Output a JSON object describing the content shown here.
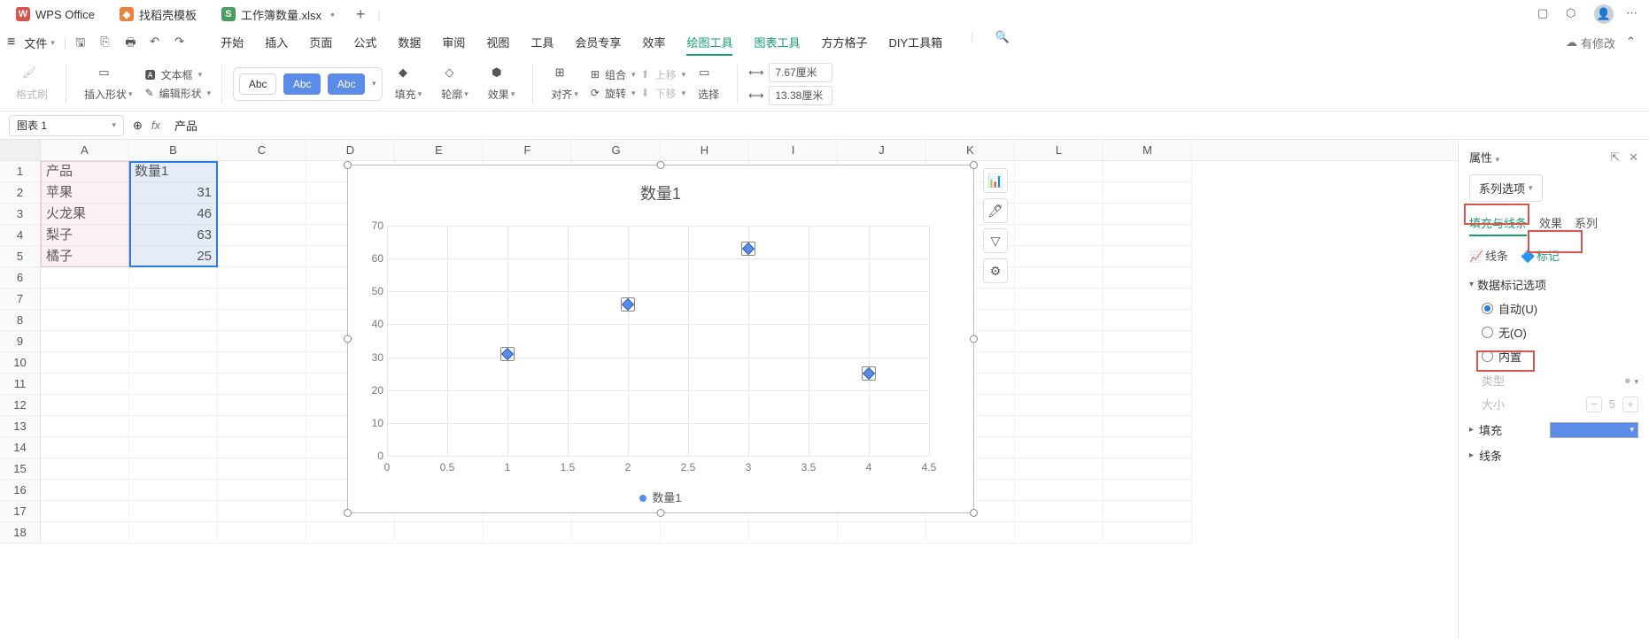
{
  "title_tabs": [
    {
      "icon": "wps",
      "label": "WPS Office"
    },
    {
      "icon": "orange",
      "label": "找稻壳模板"
    },
    {
      "icon": "green",
      "label": "工作簿数量.xlsx",
      "active": true,
      "closable": true
    }
  ],
  "menu": {
    "file": "文件",
    "tabs": [
      "开始",
      "插入",
      "页面",
      "公式",
      "数据",
      "审阅",
      "视图",
      "工具",
      "会员专享",
      "效率",
      "绘图工具",
      "图表工具",
      "方方格子",
      "DIY工具箱"
    ],
    "active_green": [
      "绘图工具",
      "图表工具"
    ],
    "cloud": "有修改"
  },
  "ribbon": {
    "format_painter": "格式刷",
    "insert_shape": "插入形状",
    "text_box": "文本框",
    "edit_shape": "编辑形状",
    "abc": "Abc",
    "fill": "填充",
    "outline": "轮廓",
    "effect": "效果",
    "align": "对齐",
    "group": "组合",
    "rotate": "旋转",
    "up": "上移",
    "down": "下移",
    "select": "选择",
    "w": "7.67厘米",
    "h": "13.38厘米"
  },
  "name_box": "图表 1",
  "fx_val": "产品",
  "columns": [
    "A",
    "B",
    "C",
    "D",
    "E",
    "F",
    "G",
    "H",
    "I",
    "J",
    "K",
    "L",
    "M"
  ],
  "rows_count": 18,
  "cells": {
    "A1": "产品",
    "B1": "数量1",
    "A2": "苹果",
    "B2": "31",
    "A3": "火龙果",
    "B3": "46",
    "A4": "梨子",
    "B4": "63",
    "A5": "橘子",
    "B5": "25"
  },
  "chart_data": {
    "type": "scatter",
    "title": "数量1",
    "series": [
      {
        "name": "数量1",
        "x": [
          1,
          2,
          3,
          4
        ],
        "y": [
          31,
          46,
          63,
          25
        ]
      }
    ],
    "xlim": [
      0,
      4.5
    ],
    "ylim": [
      0,
      70
    ],
    "xticks": [
      0,
      0.5,
      1,
      1.5,
      2,
      2.5,
      3,
      3.5,
      4,
      4.5
    ],
    "yticks": [
      0,
      10,
      20,
      30,
      40,
      50,
      60,
      70
    ],
    "legend_pos": "bottom",
    "grid": true
  },
  "panel": {
    "title": "属性",
    "series_opts": "系列选项",
    "tabs": [
      "填充与线条",
      "效果",
      "系列"
    ],
    "subtabs": {
      "line": "线条",
      "marker": "标记"
    },
    "marker_section": "数据标记选项",
    "radios": {
      "auto": "自动(U)",
      "none": "无(O)",
      "builtin": "内置"
    },
    "type_label": "类型",
    "size_label": "大小",
    "size_val": "5",
    "fill": "填充",
    "outline": "线条"
  }
}
